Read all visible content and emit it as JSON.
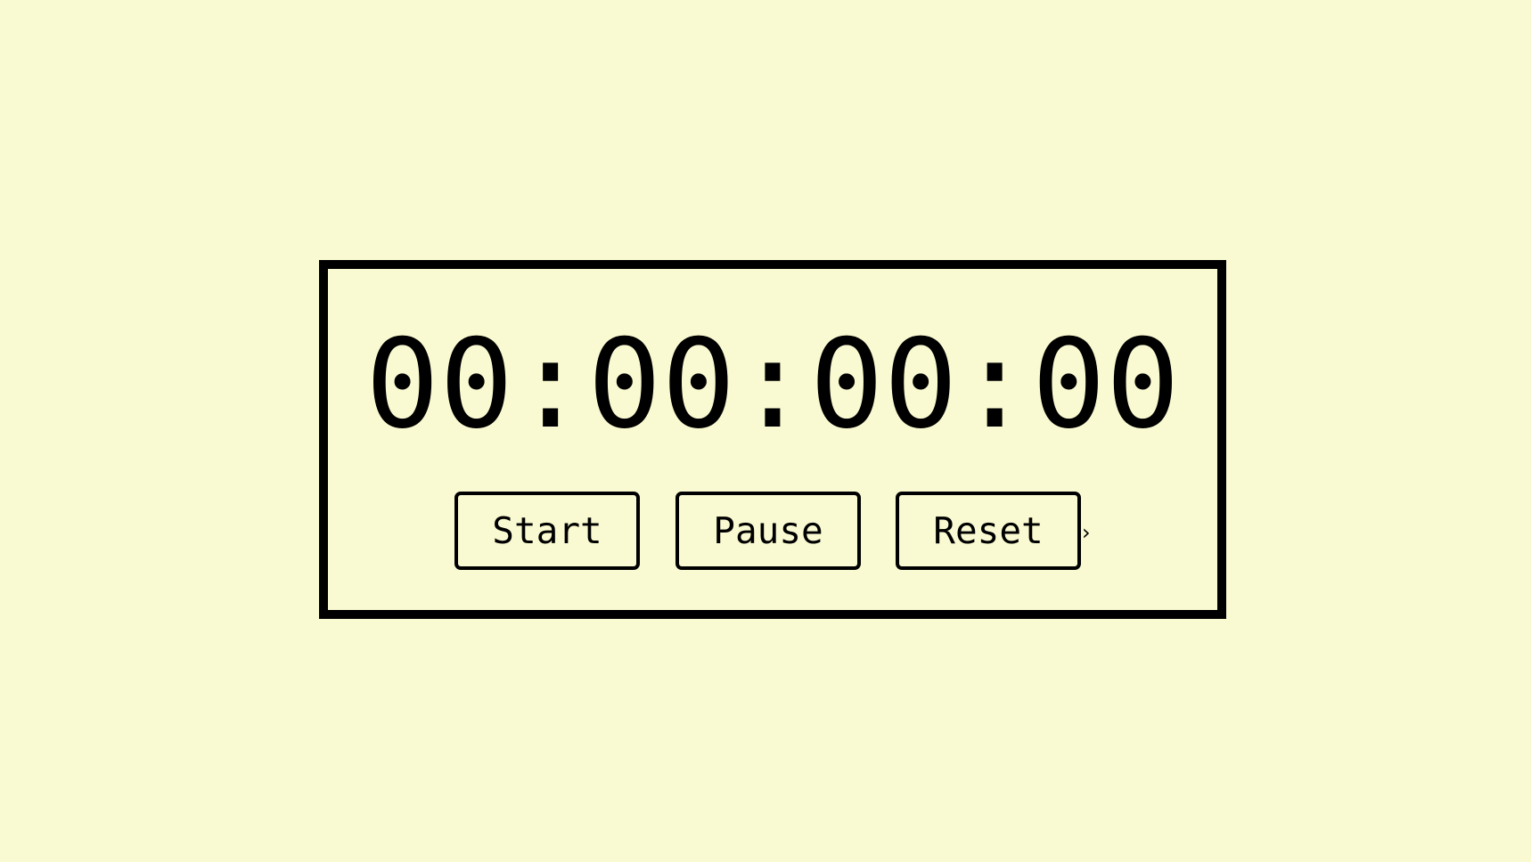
{
  "stopwatch": {
    "time": "00:00:00:00",
    "buttons": {
      "start_label": "Start",
      "pause_label": "Pause",
      "reset_label": "Reset"
    },
    "chevron_icon": "chevron-right-icon",
    "chevron_glyph": "›"
  },
  "colors": {
    "background": "#fafad2",
    "foreground": "#000000"
  }
}
